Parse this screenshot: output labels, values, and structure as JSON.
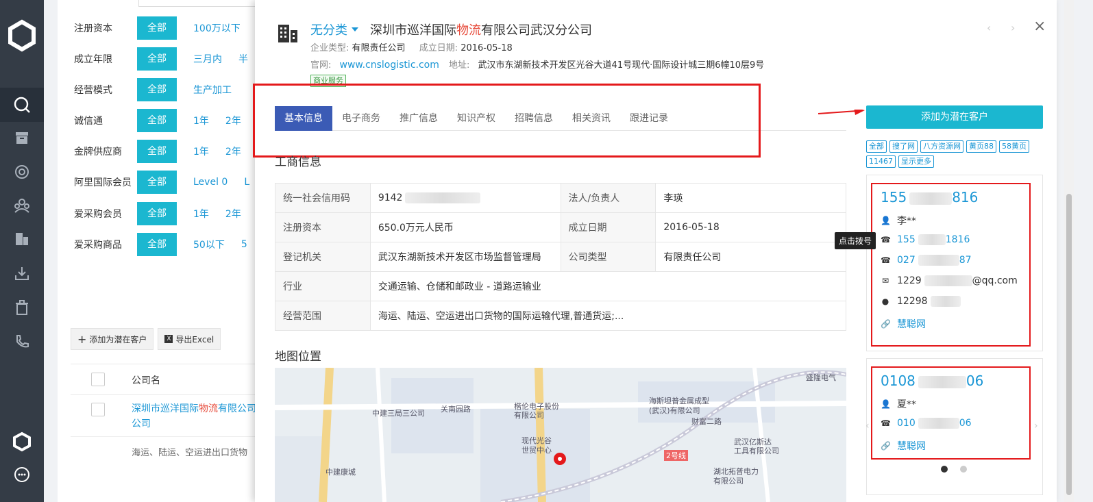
{
  "sidebar": {
    "items": [
      {
        "icon": "search-icon",
        "active": true
      },
      {
        "icon": "archive-icon"
      },
      {
        "icon": "aperture-icon"
      },
      {
        "icon": "users-group-icon"
      },
      {
        "icon": "building-icon"
      },
      {
        "icon": "download-icon"
      },
      {
        "icon": "trash-icon"
      },
      {
        "icon": "phone-call-icon"
      }
    ]
  },
  "filters": [
    {
      "label": "注册资本",
      "all": "全部",
      "options": [
        "100万以下"
      ]
    },
    {
      "label": "成立年限",
      "all": "全部",
      "options": [
        "三月内",
        "半"
      ]
    },
    {
      "label": "经营模式",
      "all": "全部",
      "options": [
        "生产加工"
      ]
    },
    {
      "label": "诚信通",
      "all": "全部",
      "options": [
        "1年",
        "2年"
      ]
    },
    {
      "label": "金牌供应商",
      "all": "全部",
      "options": [
        "1年",
        "2年"
      ]
    },
    {
      "label": "阿里国际会员",
      "all": "全部",
      "options": [
        "Level 0",
        "L"
      ]
    },
    {
      "label": "爱采购会员",
      "all": "全部",
      "options": [
        "1年",
        "2年"
      ]
    },
    {
      "label": "爱采购商品",
      "all": "全部",
      "options": [
        "50以下",
        "5"
      ]
    }
  ],
  "bg_actions": {
    "add_label": "添加为潜在客户",
    "export_label": "导出Excel"
  },
  "bg_table": {
    "col_name": "公司名",
    "row": {
      "name_pre": "深圳市巡洋国际",
      "name_hl": "物流",
      "name_post": "有限公司",
      "name_line2": "公司",
      "desc": "海运、陆运、空运进出口货物"
    }
  },
  "detail": {
    "category": "无分类",
    "name_pre": "深圳市巡洋国际",
    "name_hl": "物流",
    "name_post": "有限公司武汉分公司",
    "type_label": "企业类型:",
    "type_value": "有限责任公司",
    "founded_label": "成立日期:",
    "founded_value": "2016-05-18",
    "site_label": "官网:",
    "site_value": "www.cnslogistic.com",
    "addr_label": "地址:",
    "addr_value": "武汉市东湖新技术开发区光谷大道41号现代·国际设计城三期6幢10层9号",
    "badge": "商业服务"
  },
  "tabs": [
    "基本信息",
    "电子商务",
    "推广信息",
    "知识产权",
    "招聘信息",
    "相关资讯",
    "跟进记录"
  ],
  "business_info": {
    "title": "工商信息",
    "rows": [
      [
        {
          "k": "统一社会信用码",
          "v": "9142"
        },
        {
          "k": "法人/负责人",
          "v": "李瑛"
        }
      ],
      [
        {
          "k": "注册资本",
          "v": "650.0万元人民币"
        },
        {
          "k": "成立日期",
          "v": "2016-05-18"
        }
      ],
      [
        {
          "k": "登记机关",
          "v": "武汉东湖新技术开发区市场监督管理局"
        },
        {
          "k": "公司类型",
          "v": "有限责任公司"
        }
      ],
      [
        {
          "k": "行业",
          "v": "交通运输、仓储和邮政业 - 道路运输业"
        }
      ],
      [
        {
          "k": "经营范围",
          "v": "海运、陆运、空运进出口货物的国际运输代理,普通货运;..."
        }
      ]
    ]
  },
  "map": {
    "title": "地图位置",
    "labels": [
      "中建三局三公司",
      "关南园路",
      "楷伦电子股份",
      "有限公司",
      "海斯坦普金属成型",
      "(武汉)有限公司",
      "财富二路",
      "现代光谷",
      "世贸中心",
      "武汉亿斯达",
      "工具有限公司",
      "中建康城",
      "2号线",
      "湖北拓普电力",
      "有限公司",
      "盛隆电气"
    ]
  },
  "contacts": {
    "add_button": "添加为潜在客户",
    "sources": [
      "全部",
      "搜了网",
      "八方资源网",
      "黄页88",
      "58黄页",
      "11467",
      "显示更多"
    ],
    "tooltip": "点击拨号",
    "cards": [
      {
        "phone_a": "155",
        "phone_b": "816",
        "name": "李**",
        "mobile_a": "155",
        "mobile_b": "1816",
        "tel_a": "027",
        "tel_b": "87",
        "email_a": "1229",
        "email_b": "@qq.com",
        "qq": "12298",
        "source": "慧聪网"
      },
      {
        "phone_a": "0108",
        "phone_b": "06",
        "name": "夏**",
        "tel_a": "010",
        "tel_b": "06",
        "source": "慧聪网"
      }
    ]
  },
  "colors": {
    "accent": "#1bb7d0",
    "link": "#1a96d5",
    "tab_active": "#3b5bb5",
    "annotation": "#e4191b"
  }
}
